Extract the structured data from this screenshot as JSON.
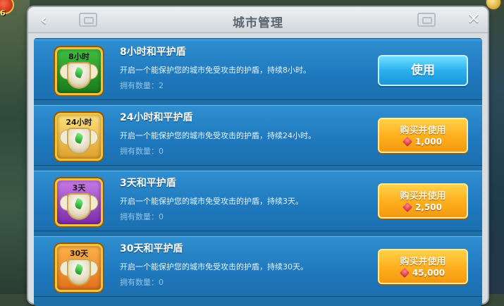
{
  "dialog": {
    "title": "城市管理"
  },
  "hud": {
    "corner_value": "6"
  },
  "colors": {
    "row_bg": "#1f78bd",
    "use_button": "#2bb0ee",
    "buy_button": "#ffae1c",
    "icon_8h": "#2a8a2a",
    "icon_24h": "#f0b03a",
    "icon_3d": "#8a3ab0",
    "icon_30d": "#f08a1a"
  },
  "items": [
    {
      "icon_label": "8小时",
      "icon": "shield-icon",
      "name": "8小时和平护盾",
      "desc": "开启一个能保护您的城市免受攻击的护盾，持续8小时。",
      "qty_label": "拥有数量：",
      "qty_value": "2",
      "action": "使用"
    },
    {
      "icon_label": "24小时",
      "icon": "shield-icon",
      "name": "24小时和平护盾",
      "desc": "开启一个能保护您的城市免受攻击的护盾，持续24小时。",
      "qty_label": "拥有数量：",
      "qty_value": "0",
      "action": "购买并使用",
      "price": "1,000"
    },
    {
      "icon_label": "3天",
      "icon": "shield-icon",
      "name": "3天和平护盾",
      "desc": "开启一个能保护您的城市免受攻击的护盾，持续3天。",
      "qty_label": "拥有数量：",
      "qty_value": "0",
      "action": "购买并使用",
      "price": "2,500"
    },
    {
      "icon_label": "30天",
      "icon": "shield-icon",
      "name": "30天和平护盾",
      "desc": "开启一个能保护您的城市免受攻击的护盾，持续30天。",
      "qty_label": "拥有数量：",
      "qty_value": "0",
      "action": "购买并使用",
      "price": "45,000"
    }
  ]
}
